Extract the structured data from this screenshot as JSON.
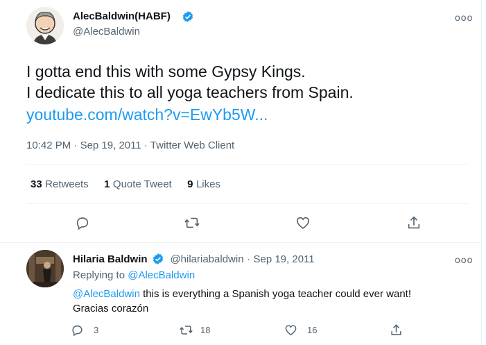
{
  "tweet": {
    "author_name": "AlecBaldwin(HABF)",
    "author_handle": "@AlecBaldwin",
    "more": "ooo",
    "text_line1": "I gotta end this with some Gypsy Kings.",
    "text_line2": "I dedicate this to all yoga teachers from Spain.",
    "link": "youtube.com/watch?v=EwYb5W...",
    "time": "10:42 PM",
    "dot1": "·",
    "date": "Sep 19, 2011",
    "dot2": "·",
    "client": "Twitter Web Client",
    "stats": {
      "retweets_count": "33",
      "retweets_label": "Retweets",
      "quotes_count": "1",
      "quotes_label": "Quote Tweet",
      "likes_count": "9",
      "likes_label": "Likes"
    }
  },
  "reply": {
    "author_name": "Hilaria Baldwin",
    "author_handle": "@hilariabaldwin",
    "dot": "·",
    "date": "Sep 19, 2011",
    "more": "ooo",
    "replying_prefix": "Replying to",
    "replying_handle": "@AlecBaldwin",
    "mention": "@AlecBaldwin",
    "text1": " this is everything a Spanish yoga teacher could ever want!",
    "text2": "Gracias corazón",
    "reply_count": "3",
    "retweet_count": "18",
    "like_count": "16"
  },
  "colors": {
    "accent": "#1d9bf0",
    "secondary_text": "#536471",
    "divider": "#eff3f4"
  },
  "icons": [
    "verified-badge-icon",
    "reply-icon",
    "retweet-icon",
    "like-icon",
    "share-icon",
    "more-icon"
  ]
}
